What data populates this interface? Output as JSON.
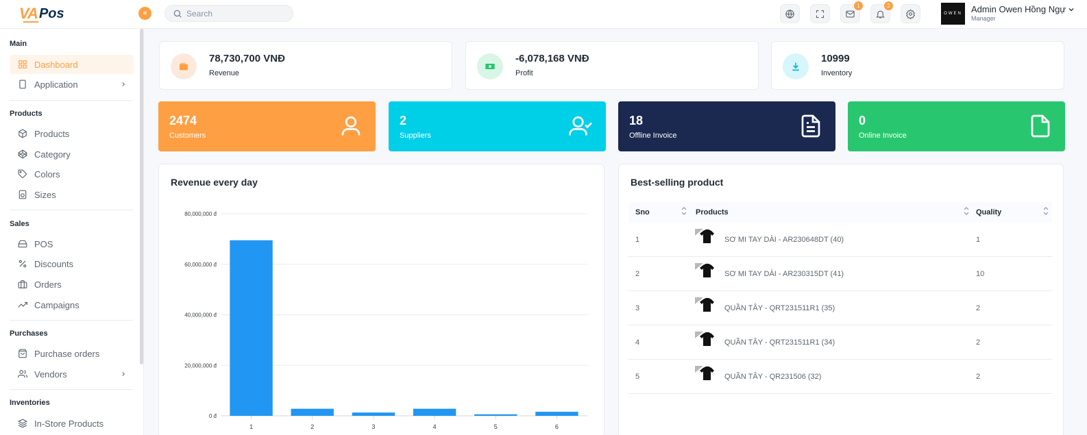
{
  "header": {
    "logo_a": "VA",
    "logo_b": "Pos",
    "search_placeholder": "Search",
    "mail_badge": "1",
    "notif_badge": "2",
    "avatar_text": "OWEN",
    "user_name": "Admin Owen Hồng Ngự",
    "user_role": "Manager",
    "icons": [
      "globe-icon",
      "fullscreen-icon",
      "mail-icon",
      "bell-icon",
      "settings-icon"
    ]
  },
  "sidebar": {
    "sections": [
      {
        "title": "Main",
        "items": [
          {
            "label": "Dashboard",
            "icon": "grid-icon",
            "active": true
          },
          {
            "label": "Application",
            "icon": "tablet-icon",
            "chevron": true
          }
        ]
      },
      {
        "title": "Products",
        "items": [
          {
            "label": "Products",
            "icon": "box-icon"
          },
          {
            "label": "Category",
            "icon": "codepen-icon"
          },
          {
            "label": "Colors",
            "icon": "tag-icon"
          },
          {
            "label": "Sizes",
            "icon": "speaker-icon"
          }
        ]
      },
      {
        "title": "Sales",
        "items": [
          {
            "label": "POS",
            "icon": "hard-drive-icon"
          },
          {
            "label": "Discounts",
            "icon": "percent-icon"
          },
          {
            "label": "Orders",
            "icon": "briefcase-icon"
          },
          {
            "label": "Campaigns",
            "icon": "trending-up-icon"
          }
        ]
      },
      {
        "title": "Purchases",
        "items": [
          {
            "label": "Purchase orders",
            "icon": "shopping-bag-icon"
          },
          {
            "label": "Vendors",
            "icon": "users-icon",
            "chevron": true
          }
        ]
      },
      {
        "title": "Inventories",
        "items": [
          {
            "label": "In-Store Products",
            "icon": "layers-icon"
          }
        ]
      }
    ]
  },
  "stats": [
    {
      "value": "78,730,700 VNĐ",
      "label": "Revenue",
      "color": "#ff9f43"
    },
    {
      "value": "-6,078,168 VNĐ",
      "label": "Profit",
      "color": "#28c76f"
    },
    {
      "value": "10999",
      "label": "Inventory",
      "color": "#00cfe8"
    }
  ],
  "count_cards": [
    {
      "value": "2474",
      "label": "Customers",
      "color": "#ff9f43"
    },
    {
      "value": "2",
      "label": "Suppliers",
      "color": "#00cfe8"
    },
    {
      "value": "18",
      "label": "Offline Invoice",
      "color": "#1b2850"
    },
    {
      "value": "0",
      "label": "Online Invoice",
      "color": "#28c76f"
    }
  ],
  "revenue_panel": {
    "title": "Revenue every day"
  },
  "chart_data": {
    "type": "bar",
    "title": "Revenue every day",
    "categories": [
      "1",
      "2",
      "3",
      "4",
      "5",
      "6"
    ],
    "values": [
      69500000,
      2800000,
      1300000,
      2800000,
      600000,
      1600000
    ],
    "ylim": [
      0,
      80000000
    ],
    "yticks": [
      0,
      20000000,
      40000000,
      60000000,
      80000000
    ],
    "ytick_labels": [
      "0 đ",
      "20,000,000 đ",
      "40,000,000 đ",
      "60,000,000 đ",
      "80,000,000 đ"
    ],
    "bar_color": "#2196f3",
    "grid": true
  },
  "best_panel": {
    "title": "Best-selling product",
    "columns": [
      "Sno",
      "Products",
      "Quality"
    ],
    "rows": [
      {
        "sno": "1",
        "product": "SƠ MI TAY DÀI - AR230648DT (40)",
        "qty": "1"
      },
      {
        "sno": "2",
        "product": "SƠ MI TAY DÀI - AR230315DT (41)",
        "qty": "10"
      },
      {
        "sno": "3",
        "product": "QUẦN TÂY - QRT231511R1 (35)",
        "qty": "2"
      },
      {
        "sno": "4",
        "product": "QUẦN TÂY - QRT231511R1 (34)",
        "qty": "2"
      },
      {
        "sno": "5",
        "product": "QUẦN TÂY - QR231506 (32)",
        "qty": "2"
      }
    ]
  }
}
